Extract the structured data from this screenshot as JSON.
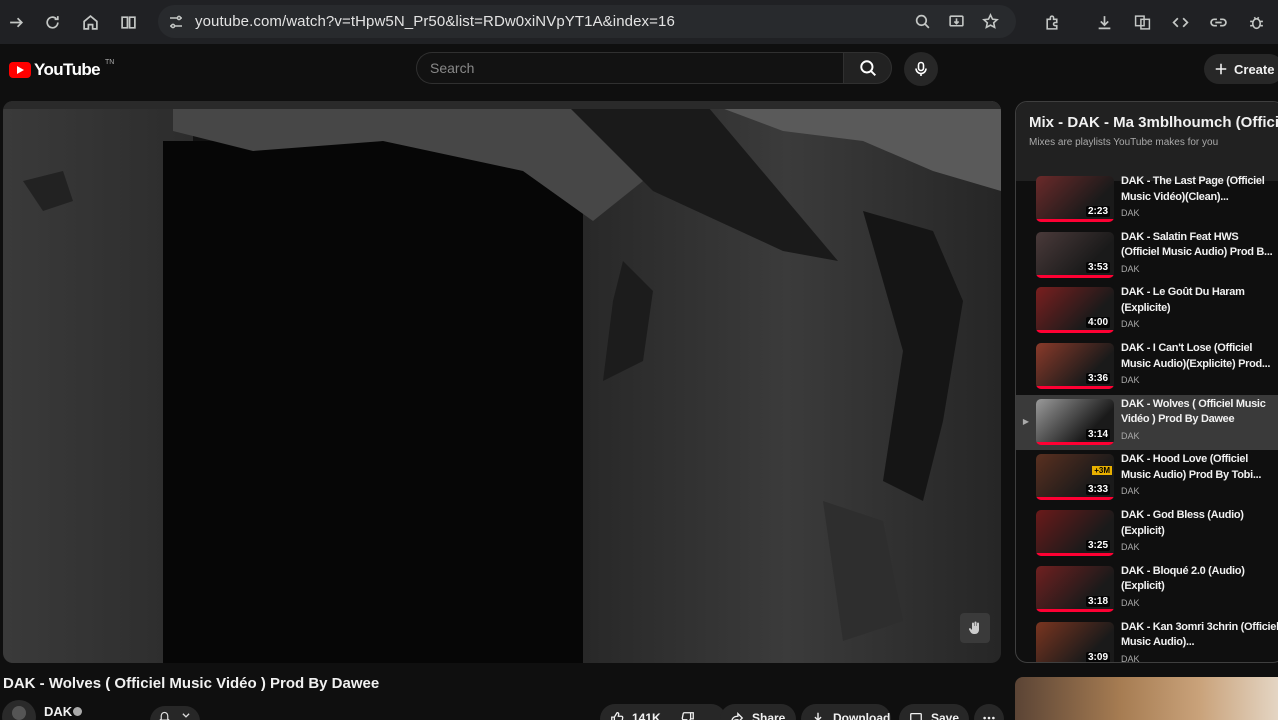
{
  "browser": {
    "url": "youtube.com/watch?v=tHpw5N_Pr50&list=RDw0xiNVpYT1A&index=16"
  },
  "youtube": {
    "logo_text": "YouTube",
    "logo_tm": "TN",
    "search_placeholder": "Search",
    "create_label": "Create"
  },
  "video": {
    "title": "DAK - Wolves ( Officiel Music Vidéo ) Prod By Dawee",
    "channel": "DAK",
    "likes": "141K",
    "share_label": "Share",
    "download_label": "Download",
    "save_label": "Save"
  },
  "playlist": {
    "title": "Mix - DAK - Ma 3mblhoumch (Offici",
    "subtitle": "Mixes are playlists YouTube makes for you",
    "items": [
      {
        "title": "DAK - The Last Page (Officiel Music Vidéo)(Clean)...",
        "channel": "DAK",
        "duration": "2:23",
        "active": false
      },
      {
        "title": "DAK - Salatin Feat HWS (Officiel Music Audio) Prod B...",
        "channel": "DAK",
        "duration": "3:53",
        "active": false
      },
      {
        "title": "DAK - Le Goût Du Haram (Explicite)",
        "channel": "DAK",
        "duration": "4:00",
        "active": false
      },
      {
        "title": "DAK - I Can't Lose (Officiel Music Audio)(Explicite) Prod...",
        "channel": "DAK",
        "duration": "3:36",
        "active": false
      },
      {
        "title": "DAK - Wolves ( Officiel Music Vidéo ) Prod By Dawee",
        "channel": "DAK",
        "duration": "3:14",
        "active": true
      },
      {
        "title": "DAK - Hood Love (Officiel Music Audio) Prod By Tobi...",
        "channel": "DAK",
        "duration": "3:33",
        "badge": "+3M",
        "active": false
      },
      {
        "title": "DAK - God Bless (Audio) (Explicit)",
        "channel": "DAK",
        "duration": "3:25",
        "active": false
      },
      {
        "title": "DAK - Bloqué 2.0 (Audio) (Explicit)",
        "channel": "DAK",
        "duration": "3:18",
        "active": false
      },
      {
        "title": "DAK - Kan 3omri 3chrin (Officiel Music Audio)...",
        "channel": "DAK",
        "duration": "3:09",
        "active": false
      }
    ]
  }
}
